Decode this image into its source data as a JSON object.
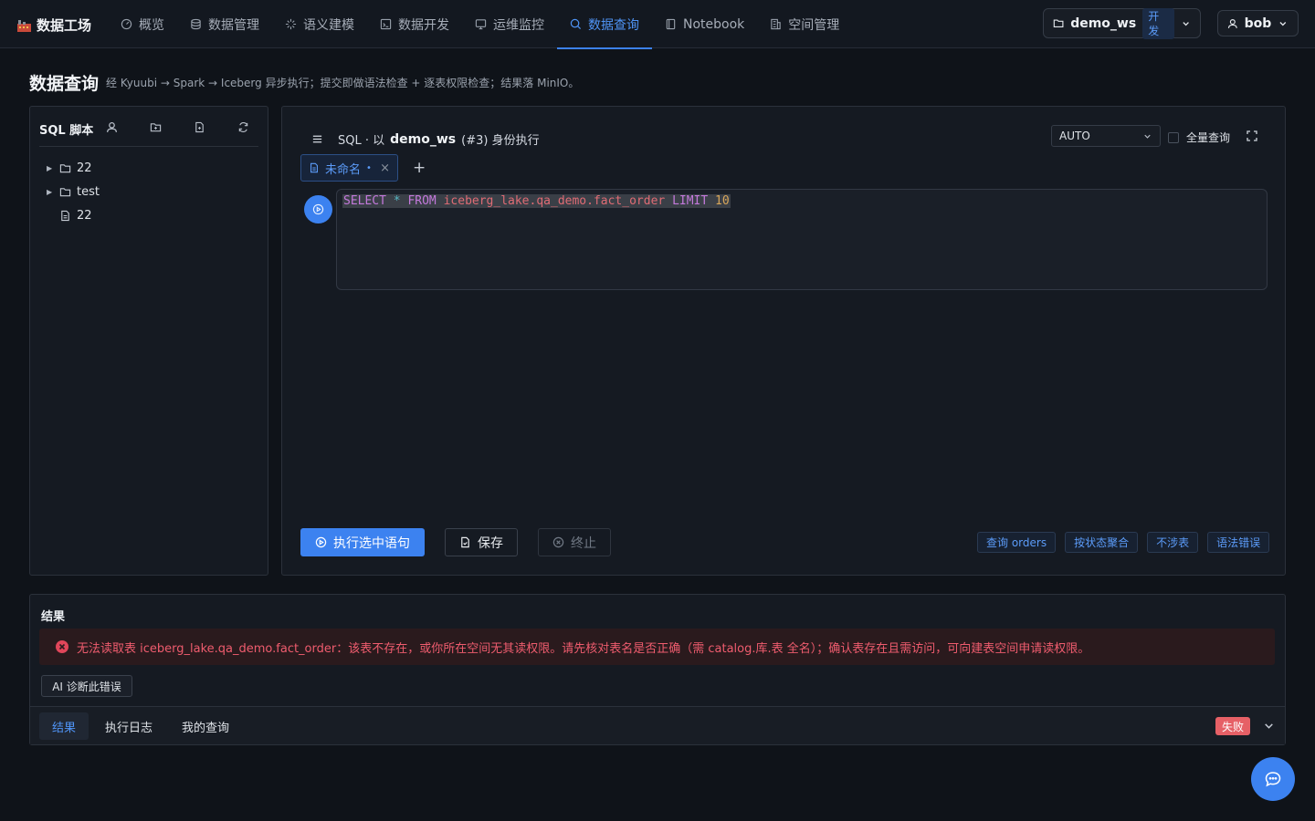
{
  "app": {
    "title": "数据工场",
    "logo_icon": "factory-icon"
  },
  "nav": {
    "items": [
      {
        "label": "概览",
        "icon": "dashboard-icon",
        "active": false
      },
      {
        "label": "数据管理",
        "icon": "database-icon",
        "active": false
      },
      {
        "label": "语义建模",
        "icon": "sparkle-icon",
        "active": false
      },
      {
        "label": "数据开发",
        "icon": "code-icon",
        "active": false
      },
      {
        "label": "运维监控",
        "icon": "monitor-icon",
        "active": false
      },
      {
        "label": "数据查询",
        "icon": "search-icon",
        "active": true
      },
      {
        "label": "Notebook",
        "icon": "notebook-icon",
        "active": false
      },
      {
        "label": "空间管理",
        "icon": "building-icon",
        "active": false
      }
    ]
  },
  "workspace": {
    "name": "demo_ws",
    "env_badge": "开发"
  },
  "user": {
    "name": "bob"
  },
  "page": {
    "title": "数据查询",
    "description": "经 Kyuubi → Spark → Iceberg 异步执行；提交即做语法检查 + 逐表权限检查；结果落 MinIO。"
  },
  "scripts_panel": {
    "title": "SQL 脚本",
    "tree": [
      {
        "label": "22",
        "type": "folder"
      },
      {
        "label": "test",
        "type": "folder"
      },
      {
        "label": "22",
        "type": "file"
      }
    ]
  },
  "editor": {
    "header_prefix": "SQL · 以",
    "header_ws": "demo_ws",
    "header_suffix": "(#3) 身份执行",
    "mode": "AUTO",
    "full_query_label": "全量查询",
    "tab_label": "未命名",
    "tab_dirty_marker": "•",
    "tab_close": "×",
    "tab_add": "+",
    "sql": {
      "kw_select": "SELECT",
      "star": "*",
      "kw_from": "FROM",
      "table": "iceberg_lake.qa_demo.fact_order",
      "kw_limit": "LIMIT",
      "limit": "10"
    },
    "buttons": {
      "run_selected": "执行选中语句",
      "save": "保存",
      "stop": "终止"
    },
    "quick_actions": [
      "查询 orders",
      "按状态聚合",
      "不涉表",
      "语法错误"
    ]
  },
  "result": {
    "title": "结果",
    "error_message": "无法读取表 iceberg_lake.qa_demo.fact_order：该表不存在，或你所在空间无其读权限。请先核对表名是否正确（需 catalog.库.表 全名）；确认表存在且需访问，可向建表空间申请读权限。",
    "ai_diagnose": "AI 诊断此错误",
    "tabs": [
      "结果",
      "执行日志",
      "我的查询"
    ],
    "status": "失败"
  },
  "colors": {
    "accent": "#3c82f0",
    "error": "#ef5c6e",
    "status_fail": "#e66066"
  }
}
